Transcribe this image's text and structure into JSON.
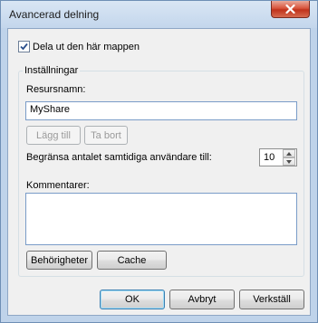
{
  "window": {
    "title": "Avancerad delning"
  },
  "share": {
    "checkbox_label": "Dela ut den här mappen",
    "checked": true
  },
  "settings": {
    "group_label": "Inställningar",
    "share_name_label": "Resursnamn:",
    "share_name_value": "MyShare",
    "add_label": "Lägg till",
    "remove_label": "Ta bort",
    "limit_label": "Begränsa antalet samtidiga användare till:",
    "limit_value": "10",
    "comments_label": "Kommentarer:",
    "comments_value": "",
    "permissions_label": "Behörigheter",
    "cache_label": "Cache"
  },
  "footer": {
    "ok_label": "OK",
    "cancel_label": "Avbryt",
    "apply_label": "Verkställ"
  },
  "colors": {
    "close_button": "#c8432b",
    "title_bar": "#c9daee",
    "client_bg": "#f0f0f0"
  },
  "icons": {
    "close": "close-icon",
    "check": "check-icon",
    "spin_up": "spin-up-icon",
    "spin_down": "spin-down-icon"
  }
}
